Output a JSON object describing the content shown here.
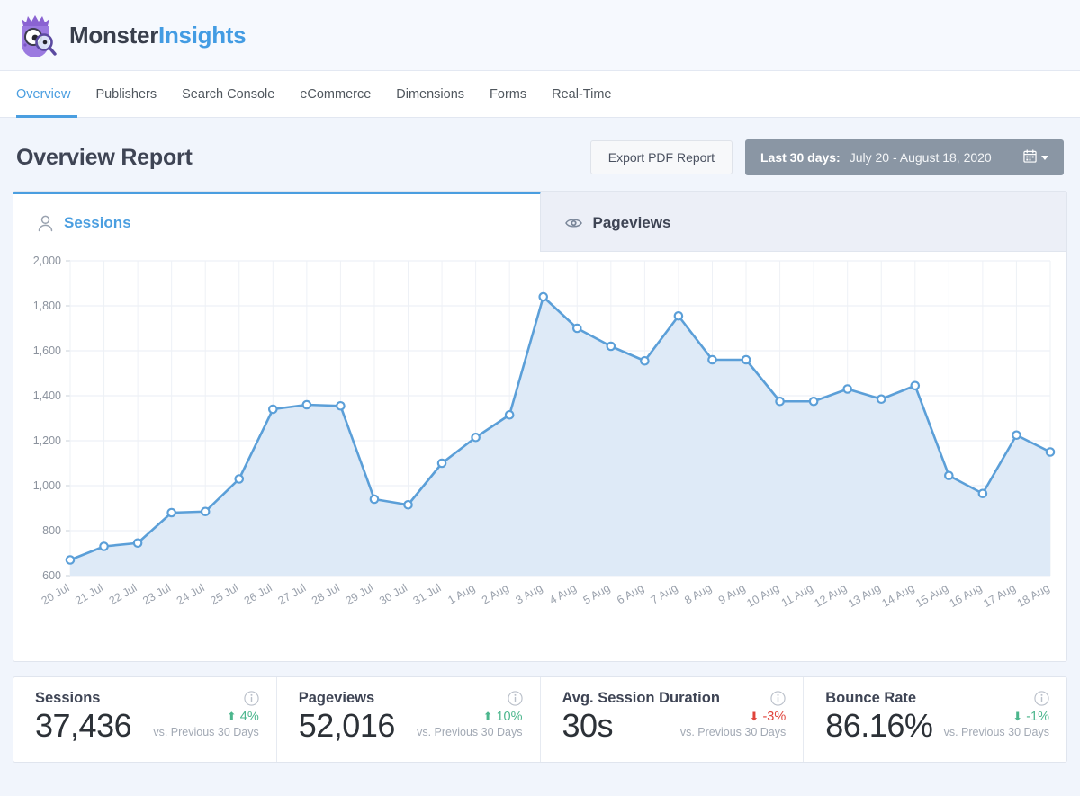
{
  "brand": {
    "name_part1": "Monster",
    "name_part2": "Insights",
    "logo_icon": "monster-magnifier-logo",
    "accent_color": "#439ce3",
    "dark_color": "#393f4c"
  },
  "nav": {
    "items": [
      {
        "label": "Overview",
        "active": true
      },
      {
        "label": "Publishers",
        "active": false
      },
      {
        "label": "Search Console",
        "active": false
      },
      {
        "label": "eCommerce",
        "active": false
      },
      {
        "label": "Dimensions",
        "active": false
      },
      {
        "label": "Forms",
        "active": false
      },
      {
        "label": "Real-Time",
        "active": false
      }
    ]
  },
  "header": {
    "title": "Overview Report",
    "export_button": "Export PDF Report",
    "date_range_label": "Last 30 days:",
    "date_range_value": "July 20 - August 18, 2020",
    "calendar_icon": "calendar-icon",
    "caret_icon": "chevron-down-icon"
  },
  "chart_tabs": [
    {
      "label": "Sessions",
      "icon": "user-icon",
      "active": true
    },
    {
      "label": "Pageviews",
      "icon": "eye-icon",
      "active": false
    }
  ],
  "chart_data": {
    "type": "area",
    "title": "Sessions",
    "xlabel": "",
    "ylabel": "",
    "ylim": [
      600,
      2000
    ],
    "yticks": [
      600,
      800,
      1000,
      1200,
      1400,
      1600,
      1800,
      2000
    ],
    "ytick_labels": [
      "600",
      "800",
      "1,000",
      "1,200",
      "1,400",
      "1,600",
      "1,800",
      "2,000"
    ],
    "grid": true,
    "legend": "none",
    "line_color": "#5b9fd8",
    "fill_color": "#dce9f7",
    "point_fill": "#ffffff",
    "categories": [
      "20 Jul",
      "21 Jul",
      "22 Jul",
      "23 Jul",
      "24 Jul",
      "25 Jul",
      "26 Jul",
      "27 Jul",
      "28 Jul",
      "29 Jul",
      "30 Jul",
      "31 Jul",
      "1 Aug",
      "2 Aug",
      "3 Aug",
      "4 Aug",
      "5 Aug",
      "6 Aug",
      "7 Aug",
      "8 Aug",
      "9 Aug",
      "10 Aug",
      "11 Aug",
      "12 Aug",
      "13 Aug",
      "14 Aug",
      "15 Aug",
      "16 Aug",
      "17 Aug",
      "18 Aug"
    ],
    "values": [
      670,
      730,
      745,
      880,
      885,
      1030,
      1340,
      1360,
      1355,
      940,
      915,
      1100,
      1215,
      1315,
      1840,
      1700,
      1620,
      1555,
      1755,
      1560,
      1560,
      1375,
      1375,
      1430,
      1385,
      1445,
      1045,
      965,
      1225,
      1150
    ]
  },
  "stats": [
    {
      "label": "Sessions",
      "value": "37,436",
      "delta": "4%",
      "delta_direction": "up",
      "delta_tone": "positive",
      "sub": "vs. Previous 30 Days",
      "info_icon": "info-icon"
    },
    {
      "label": "Pageviews",
      "value": "52,016",
      "delta": "10%",
      "delta_direction": "up",
      "delta_tone": "positive",
      "sub": "vs. Previous 30 Days",
      "info_icon": "info-icon"
    },
    {
      "label": "Avg. Session Duration",
      "value": "30s",
      "delta": "-3%",
      "delta_direction": "down",
      "delta_tone": "negative",
      "sub": "vs. Previous 30 Days",
      "info_icon": "info-icon"
    },
    {
      "label": "Bounce Rate",
      "value": "86.16%",
      "delta": "-1%",
      "delta_direction": "down",
      "delta_tone": "positive",
      "sub": "vs. Previous 30 Days",
      "info_icon": "info-icon"
    }
  ],
  "colors": {
    "accent": "#4a9ee0",
    "positive": "#4cb68d",
    "negative": "#e0443c",
    "page_bg": "#f1f5fc"
  }
}
